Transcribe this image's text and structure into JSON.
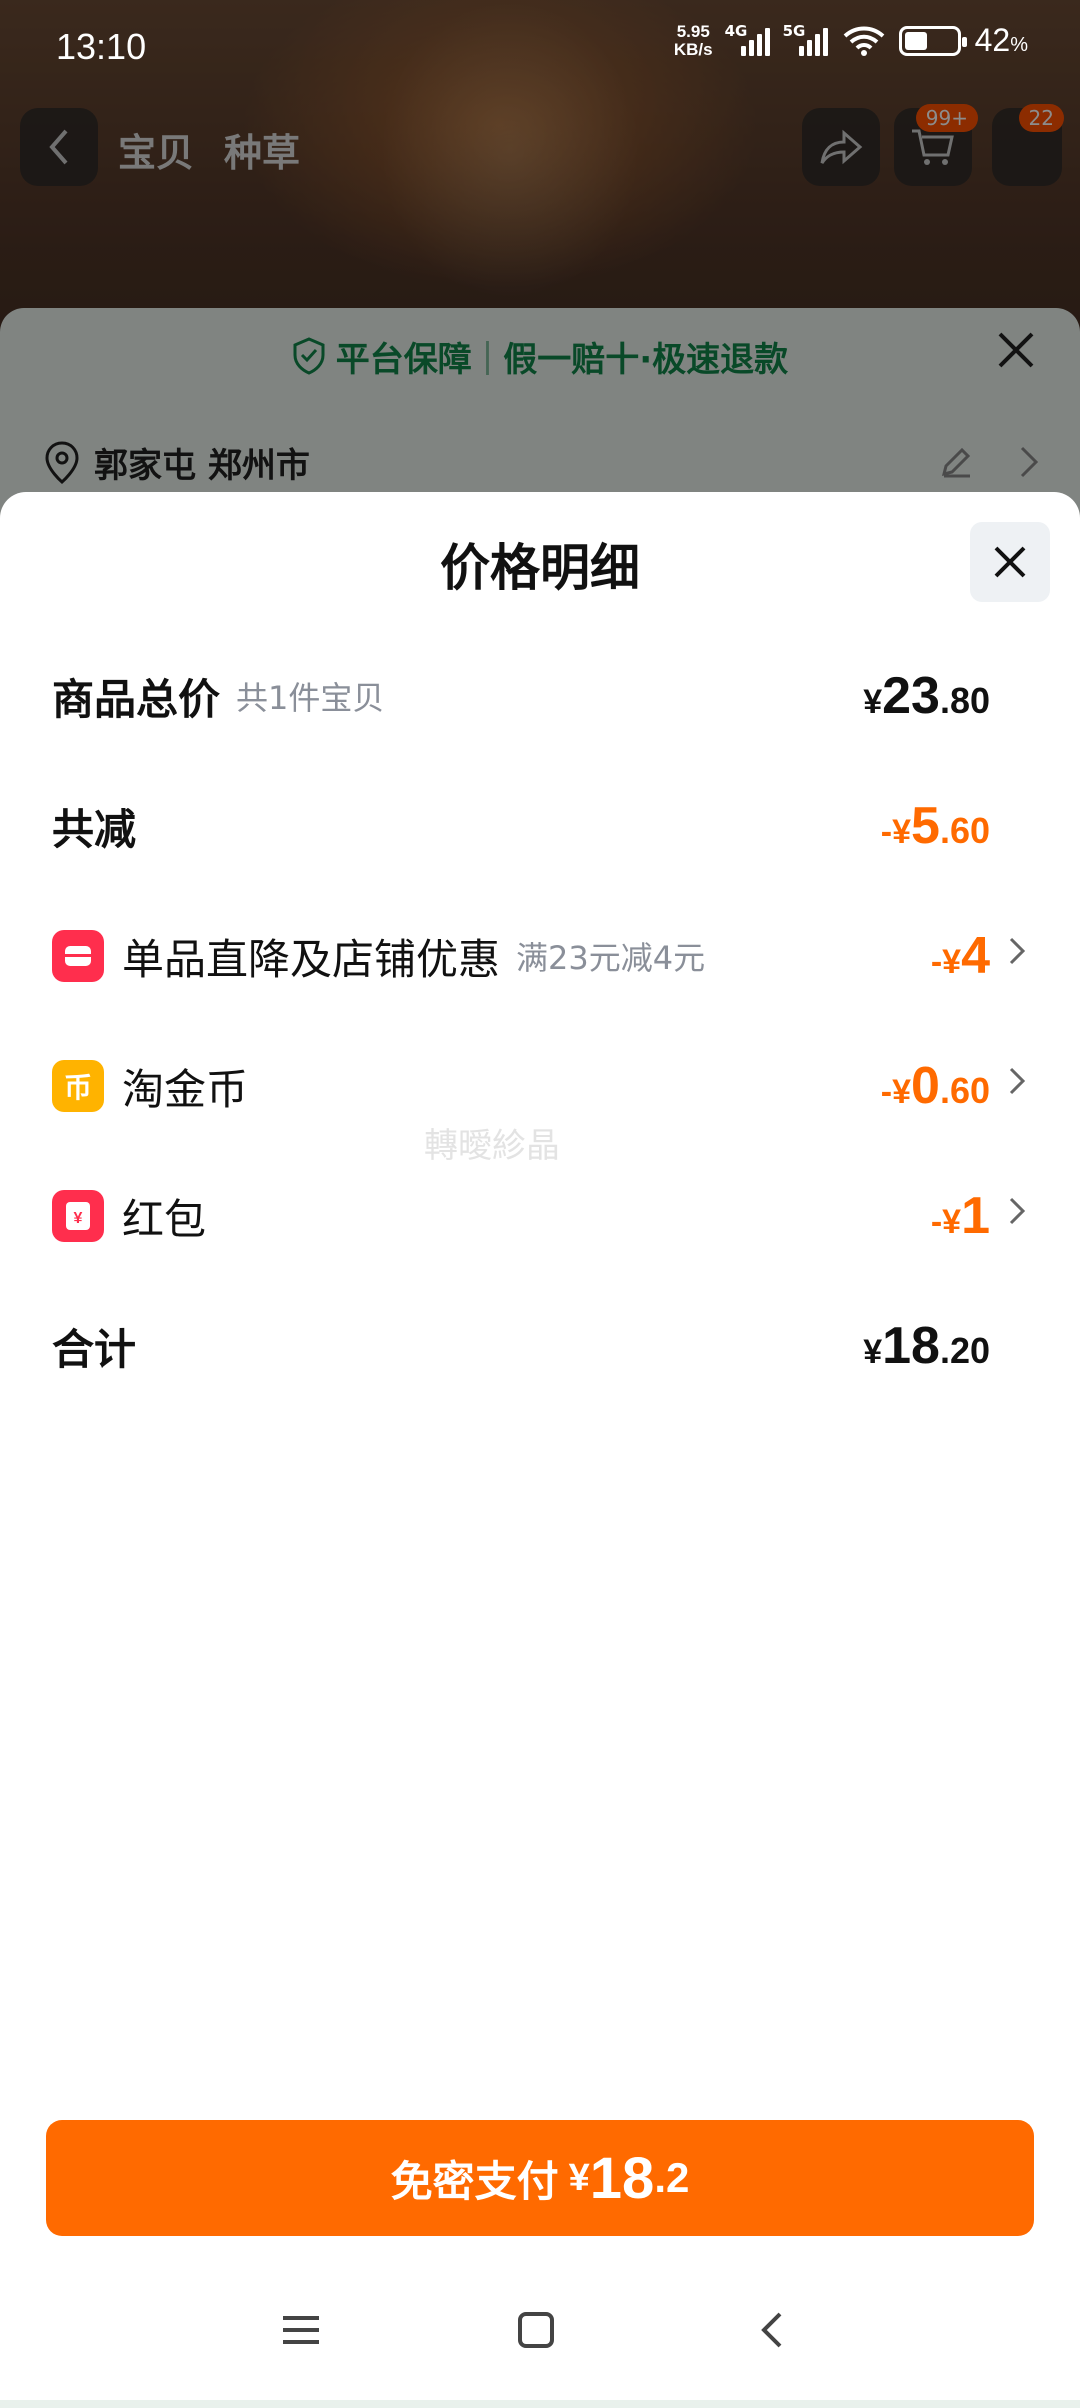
{
  "status_bar": {
    "time": "13:10",
    "net_speed_value": "5.95",
    "net_speed_unit": "KB/s",
    "sim1_tag": "4G",
    "sim2_tag": "5G",
    "battery_percent": "42",
    "battery_symbol": "%"
  },
  "product_nav": {
    "tabs": [
      "宝贝",
      "种草"
    ],
    "cart_badge": "99+",
    "msg_badge": "22"
  },
  "guarantee_bar": {
    "title": "平台保障",
    "divider": "|",
    "text": "假一赔十·极速退款"
  },
  "address": {
    "text": "郭家屯 郑州市"
  },
  "price_sheet": {
    "title": "价格明细",
    "rows": [
      {
        "label": "商品总价",
        "sub": "共1件宝贝",
        "currency": "¥",
        "int": "23",
        "dec": ".80"
      },
      {
        "label": "共减",
        "currency": "-¥",
        "int": "5",
        "dec": ".60"
      },
      {
        "label": "单品直降及店铺优惠",
        "sub": "满23元减4元",
        "currency": "-¥",
        "int": "4",
        "dec": ""
      },
      {
        "label": "淘金币",
        "currency": "-¥",
        "int": "0",
        "dec": ".60"
      },
      {
        "label": "红包",
        "currency": "-¥",
        "int": "1",
        "dec": ""
      },
      {
        "label": "合计",
        "currency": "¥",
        "int": "18",
        "dec": ".20"
      }
    ],
    "watermark": "轉曖紾晶"
  },
  "pay_button": {
    "label": "免密支付",
    "currency": "¥",
    "int": "18",
    "dec": ".2"
  },
  "colors": {
    "accent_orange": "#ff6a00",
    "guarantee_green": "#11864a"
  }
}
